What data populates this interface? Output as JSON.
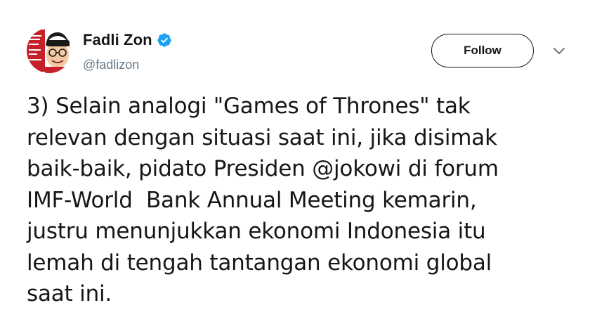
{
  "user": {
    "display_name": "Fadli Zon",
    "handle": "@fadlizon",
    "verified": true,
    "avatar_icon": "user-avatar-icon"
  },
  "actions": {
    "follow_label": "Follow",
    "menu_icon": "chevron-down-icon"
  },
  "tweet": {
    "lines": [
      "3) Selain analogi \"Games of Thrones\" tak",
      "relevan dengan situasi saat ini, jika disimak",
      "baik-baik, pidato Presiden @jokowi di forum",
      "IMF-World  Bank Annual Meeting kemarin,",
      "justru menunjukkan ekonomi Indonesia itu",
      "lemah di tengah tantangan ekonomi global",
      "saat ini."
    ]
  },
  "colors": {
    "text": "#14171a",
    "secondary": "#657786",
    "verified_badge": "#1da1f2",
    "follow_border": "#14171a"
  }
}
